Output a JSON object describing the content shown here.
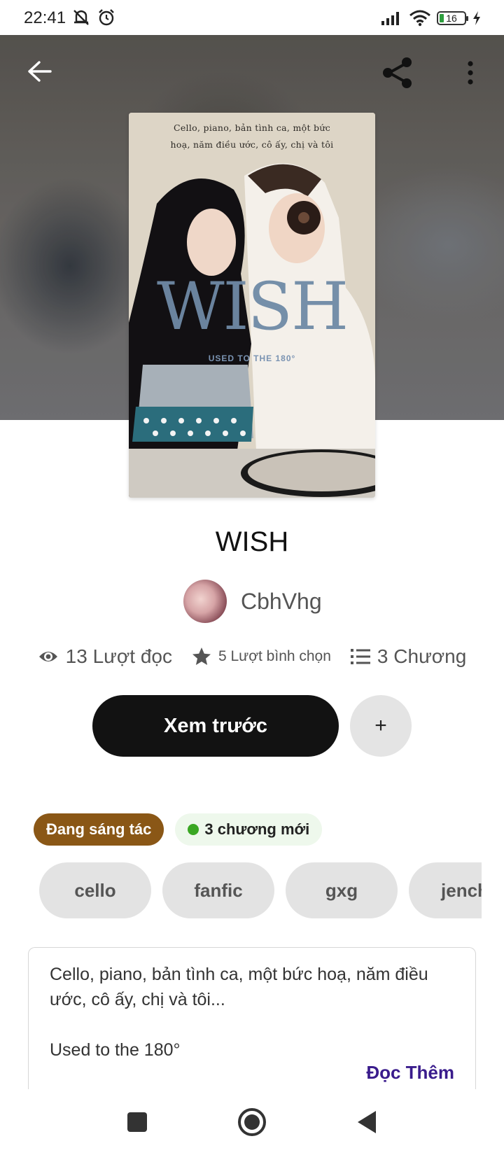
{
  "status_bar": {
    "time": "22:41",
    "battery": "16",
    "icons": [
      "mute-icon",
      "alarm-icon",
      "signal-icon",
      "wifi-icon",
      "battery-icon",
      "charging-icon"
    ]
  },
  "header": {
    "back_icon": "arrow-left-icon",
    "share_icon": "share-icon",
    "more_icon": "more-vertical-icon"
  },
  "cover": {
    "caption_line1": "Cello, piano, bản tình ca, một bức",
    "caption_line2": "hoạ, năm điều ước, cô ấy, chị và tôi",
    "title": "WISH",
    "subtitle": "USED TO THE 180°"
  },
  "book": {
    "title": "WISH",
    "author": "CbhVhg"
  },
  "stats": {
    "reads": "13 Lượt đọc",
    "votes": "5 Lượt bình chọn",
    "chapters": "3 Chương"
  },
  "actions": {
    "preview_label": "Xem trước",
    "add_label": "+"
  },
  "badges": {
    "status": "Đang sáng tác",
    "new_chapters": "3 chương mới",
    "status_color": "#8a5716",
    "new_dot_color": "#3aa723"
  },
  "tags": [
    "cello",
    "fanfic",
    "gxg",
    "jench"
  ],
  "description": {
    "line1": "Cello, piano, bản tình ca, một bức hoạ, năm điều",
    "line2": "ước, cô ấy, chị và tôi...",
    "line3": "Used to the 180°",
    "read_more": "Đọc Thêm"
  },
  "nav": {
    "items": [
      "recents-icon",
      "home-icon",
      "back-icon"
    ]
  }
}
